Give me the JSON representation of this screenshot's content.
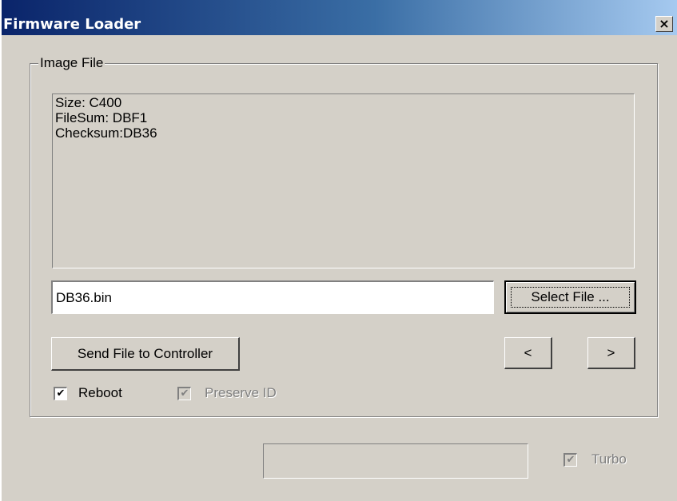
{
  "window": {
    "title": "Firmware Loader",
    "close_glyph": "×"
  },
  "image_file_group": {
    "label": "Image File",
    "info_lines": [
      "Size: C400",
      "FileSum: DBF1",
      "Checksum:DB36"
    ],
    "file_name_value": "DB36.bin",
    "select_file_label": "Select File ...",
    "send_file_label": "Send File to Controller",
    "prev_label": "<",
    "next_label": ">",
    "reboot": {
      "label": "Reboot",
      "checked": true,
      "enabled": true,
      "mark": "✔"
    },
    "preserve_id": {
      "label": "Preserve ID",
      "checked": true,
      "enabled": false,
      "mark": "✔"
    }
  },
  "footer": {
    "progress_fraction": 0,
    "turbo": {
      "label": "Turbo",
      "checked": true,
      "enabled": false,
      "mark": "✔"
    }
  },
  "colors": {
    "face": "#d4d0c8",
    "title_start": "#0a246a",
    "title_end": "#a6caf0"
  }
}
